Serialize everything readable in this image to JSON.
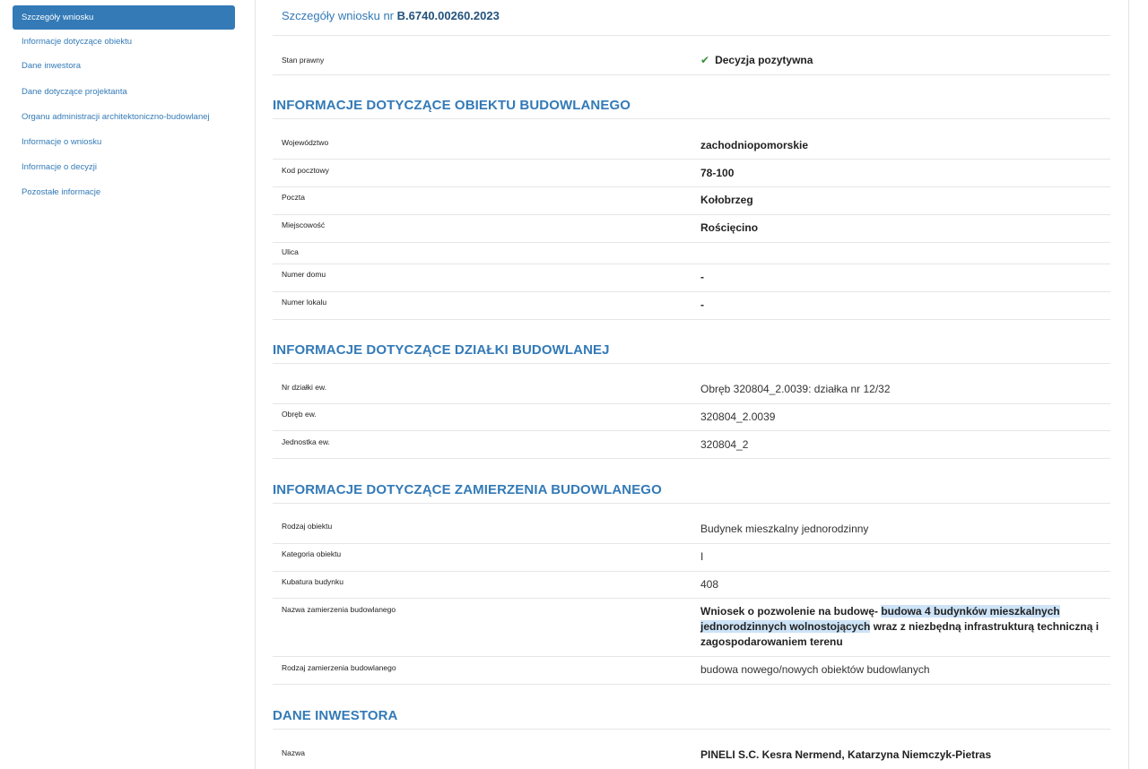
{
  "sidebar": {
    "items": [
      {
        "label": "Szczegóły wniosku",
        "active": true
      },
      {
        "label": "Informacje dotyczące obiektu"
      },
      {
        "label": "Dane inwestora"
      },
      {
        "label": "Dane dotyczące projektanta"
      },
      {
        "label": "Organu administracji architektoniczno-budowlanej"
      },
      {
        "label": "Informacje o wniosku"
      },
      {
        "label": "Informacje o decyzji"
      },
      {
        "label": "Pozostałe informacje"
      }
    ]
  },
  "header": {
    "title_prefix": "Szczegóły wniosku nr ",
    "application_number": "B.6740.00260.2023"
  },
  "status": {
    "label": "Stan prawny",
    "value": "Decyzja pozytywna",
    "icon": "check-icon",
    "icon_color": "#3c8f3c"
  },
  "sections": {
    "object": {
      "heading": "INFORMACJE DOTYCZĄCE OBIEKTU BUDOWLANEGO",
      "rows": [
        {
          "label": "Województwo",
          "value": "zachodniopomorskie"
        },
        {
          "label": "Kod pocztowy",
          "value": "78-100"
        },
        {
          "label": "Poczta",
          "value": "Kołobrzeg"
        },
        {
          "label": "Miejscowość",
          "value": "Rościęcino"
        },
        {
          "label": "Ulica",
          "value": ""
        },
        {
          "label": "Numer domu",
          "value": "-"
        },
        {
          "label": "Numer lokalu",
          "value": "-"
        }
      ]
    },
    "plot": {
      "heading": "INFORMACJE DOTYCZĄCE DZIAŁKI BUDOWLANEJ",
      "rows": [
        {
          "label": "Nr działki ew.",
          "value": "Obręb 320804_2.0039: działka nr 12/32"
        },
        {
          "label": "Obręb ew.",
          "value": "320804_2.0039"
        },
        {
          "label": "Jednostka ew.",
          "value": "320804_2"
        }
      ]
    },
    "project": {
      "heading": "INFORMACJE DOTYCZĄCE ZAMIERZENIA BUDOWLANEGO",
      "rows": [
        {
          "label": "Rodzaj obiektu",
          "value": "Budynek mieszkalny jednorodzinny"
        },
        {
          "label": "Kategoria obiektu",
          "value": "I"
        },
        {
          "label": "Kubatura budynku",
          "value": "408"
        },
        {
          "label": "Nazwa zamierzenia budowlanego",
          "value_part1": "Wniosek o pozwolenie na budowę- ",
          "value_highlight": "budowa 4 budynków mieszkalnych jednorodzinnych wolnostojących",
          "value_part2": " wraz z niezbędną infrastrukturą techniczną i zagospodarowaniem terenu"
        },
        {
          "label": "Rodzaj zamierzenia budowlanego",
          "value": "budowa nowego/nowych obiektów budowlanych"
        }
      ]
    },
    "investor": {
      "heading": "DANE INWESTORA",
      "rows": [
        {
          "label": "Nazwa",
          "value": "PINELI S.C. Kesra Nermend, Katarzyna Niemczyk-Pietras"
        }
      ]
    }
  },
  "colors": {
    "accent": "#337ab7",
    "highlight": "#cde3f7"
  }
}
